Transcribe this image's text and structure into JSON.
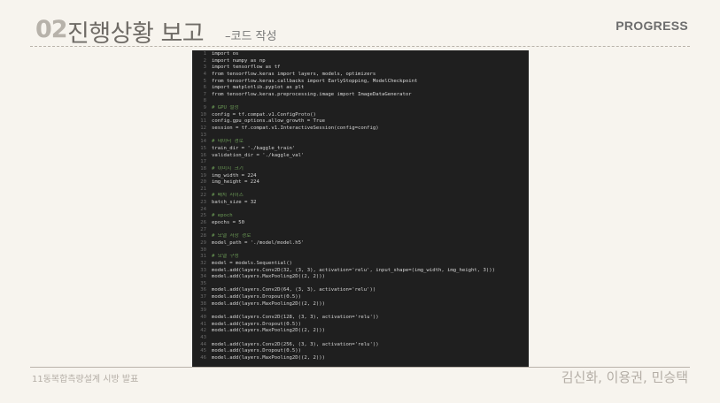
{
  "header": {
    "number": "02",
    "title": "진행상황 보고",
    "subtitle": "–코드 작성",
    "section_label": "PROGRESS"
  },
  "footer": {
    "left": "11동복합측량설계 시방 발표",
    "right": "김신화, 이용권, 민승택"
  },
  "code": {
    "lines": [
      {
        "n": "1",
        "t": "import os",
        "k": "kw"
      },
      {
        "n": "2",
        "t": "import numpy as np",
        "k": "kw"
      },
      {
        "n": "3",
        "t": "import tensorflow as tf",
        "k": "kw"
      },
      {
        "n": "4",
        "t": "from tensorflow.keras import layers, models, optimizers",
        "k": "kw"
      },
      {
        "n": "5",
        "t": "from tensorflow.keras.callbacks import EarlyStopping, ModelCheckpoint",
        "k": "kw"
      },
      {
        "n": "6",
        "t": "import matplotlib.pyplot as plt",
        "k": "kw"
      },
      {
        "n": "7",
        "t": "from tensorflow.keras.preprocessing.image import ImageDataGenerator",
        "k": "kw"
      },
      {
        "n": "8",
        "t": "",
        "k": "plain"
      },
      {
        "n": "9",
        "t": "# GPU 설정",
        "k": "comment"
      },
      {
        "n": "10",
        "t": "config = tf.compat.v1.ConfigProto()",
        "k": "plain"
      },
      {
        "n": "11",
        "t": "config.gpu_options.allow_growth = True",
        "k": "plain"
      },
      {
        "n": "12",
        "t": "session = tf.compat.v1.InteractiveSession(config=config)",
        "k": "plain"
      },
      {
        "n": "13",
        "t": "",
        "k": "plain"
      },
      {
        "n": "14",
        "t": "# 데이터 경로",
        "k": "comment"
      },
      {
        "n": "15",
        "t": "train_dir = './kaggle_train'",
        "k": "plain"
      },
      {
        "n": "16",
        "t": "validation_dir = './kaggle_val'",
        "k": "plain"
      },
      {
        "n": "17",
        "t": "",
        "k": "plain"
      },
      {
        "n": "18",
        "t": "# 이미지 크기",
        "k": "comment"
      },
      {
        "n": "19",
        "t": "img_width = 224",
        "k": "plain"
      },
      {
        "n": "20",
        "t": "img_height = 224",
        "k": "plain"
      },
      {
        "n": "21",
        "t": "",
        "k": "plain"
      },
      {
        "n": "22",
        "t": "# 배치 사이즈",
        "k": "comment"
      },
      {
        "n": "23",
        "t": "batch_size = 32",
        "k": "plain"
      },
      {
        "n": "24",
        "t": "",
        "k": "plain"
      },
      {
        "n": "25",
        "t": "# epoch",
        "k": "comment"
      },
      {
        "n": "26",
        "t": "epochs = 50",
        "k": "plain"
      },
      {
        "n": "27",
        "t": "",
        "k": "plain"
      },
      {
        "n": "28",
        "t": "# 모델 저장 경로",
        "k": "comment"
      },
      {
        "n": "29",
        "t": "model_path = './model/model.h5'",
        "k": "plain"
      },
      {
        "n": "30",
        "t": "",
        "k": "plain"
      },
      {
        "n": "31",
        "t": "# 모델 구성",
        "k": "comment"
      },
      {
        "n": "32",
        "t": "model = models.Sequential()",
        "k": "plain"
      },
      {
        "n": "33",
        "t": "model.add(layers.Conv2D(32, (3, 3), activation='relu', input_shape=(img_width, img_height, 3)))",
        "k": "plain"
      },
      {
        "n": "34",
        "t": "model.add(layers.MaxPooling2D((2, 2)))",
        "k": "plain"
      },
      {
        "n": "35",
        "t": "",
        "k": "plain"
      },
      {
        "n": "36",
        "t": "model.add(layers.Conv2D(64, (3, 3), activation='relu'))",
        "k": "plain"
      },
      {
        "n": "37",
        "t": "model.add(layers.Dropout(0.5))",
        "k": "plain"
      },
      {
        "n": "38",
        "t": "model.add(layers.MaxPooling2D((2, 2)))",
        "k": "plain"
      },
      {
        "n": "39",
        "t": "",
        "k": "plain"
      },
      {
        "n": "40",
        "t": "model.add(layers.Conv2D(128, (3, 3), activation='relu'))",
        "k": "plain"
      },
      {
        "n": "41",
        "t": "model.add(layers.Dropout(0.5))",
        "k": "plain"
      },
      {
        "n": "42",
        "t": "model.add(layers.MaxPooling2D((2, 2)))",
        "k": "plain"
      },
      {
        "n": "43",
        "t": "",
        "k": "plain"
      },
      {
        "n": "44",
        "t": "model.add(layers.Conv2D(256, (3, 3), activation='relu'))",
        "k": "plain"
      },
      {
        "n": "45",
        "t": "model.add(layers.Dropout(0.5))",
        "k": "plain"
      },
      {
        "n": "46",
        "t": "model.add(layers.MaxPooling2D((2, 2)))",
        "k": "plain"
      }
    ]
  }
}
